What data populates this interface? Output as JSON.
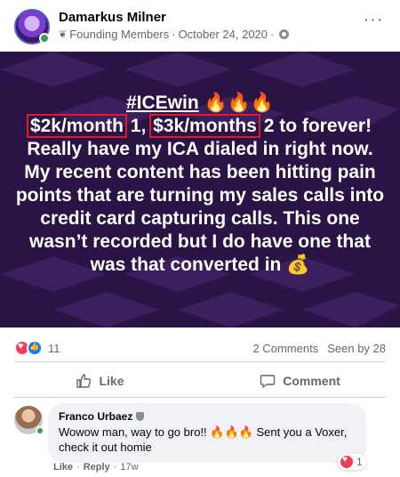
{
  "post": {
    "author": "Damarkus Milner",
    "group_badge": "Founding Members",
    "separator": "·",
    "date": "October 24, 2020",
    "separator2": "·",
    "more_label": "···"
  },
  "image": {
    "tag": "#ICEwin",
    "fire": "🔥🔥🔥",
    "highlight1": "$2k/month",
    "mid1": " 1, ",
    "highlight2": "$3k/months",
    "body": " 2 to forever! Really have my ICA dialed in right now. My recent content has been hitting pain points that are turning my sales calls into credit card capturing calls. This one wasn’t recorded but I do have one that was that converted in ",
    "moneybag": "💰",
    "colors": {
      "background": "#2a1445",
      "stripe": "#3b1f5e",
      "highlight_box": "#e01b24"
    }
  },
  "stats": {
    "reaction_count": "11",
    "comments": "2 Comments",
    "seen": "Seen by 28"
  },
  "actions": {
    "like_label": "Like",
    "comment_label": "Comment"
  },
  "comment": {
    "author": "Franco Urbaez",
    "text": "Wowow man, way to go bro!! 🔥🔥🔥 Sent you a Voxer, check it out homie",
    "like_label": "Like",
    "dot": "·",
    "reply_label": "Reply",
    "dot2": "·",
    "time": "17w",
    "reaction_count": "1"
  }
}
